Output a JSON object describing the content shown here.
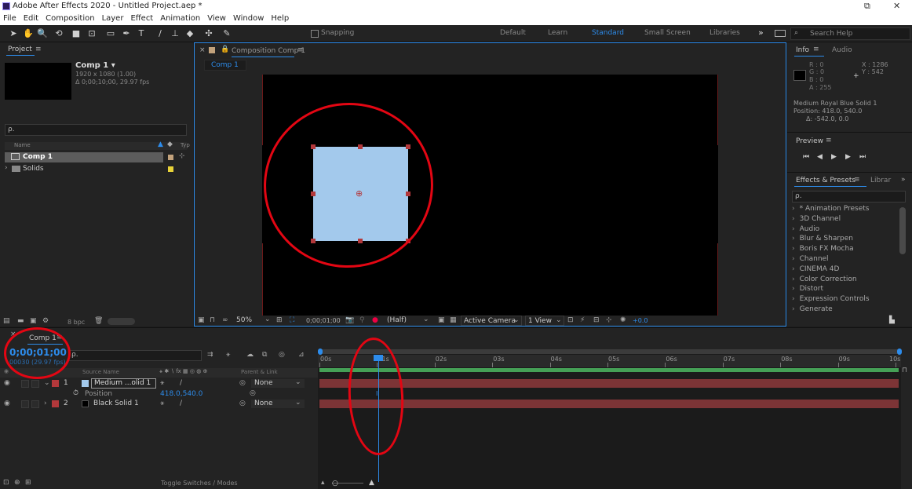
{
  "app": {
    "title": "Adobe After Effects 2020 - Untitled Project.aep *"
  },
  "menu": [
    "File",
    "Edit",
    "Composition",
    "Layer",
    "Effect",
    "Animation",
    "View",
    "Window",
    "Help"
  ],
  "window_controls": {
    "restore": "⧉",
    "close": "✕"
  },
  "workspaces": [
    "Default",
    "Learn",
    "Standard",
    "Small Screen",
    "Libraries"
  ],
  "workspace_more": "»",
  "search_help": "Search Help",
  "snapping": "Snapping",
  "project": {
    "tab": "Project",
    "comp_name": "Comp 1 ▾",
    "comp_info1": "1920 x 1080 (1.00)",
    "comp_info2": "Δ 0;00;10;00, 29.97 fps",
    "search_placeholder": "ρ.",
    "col_name": "Name",
    "col_type": "Typ",
    "items": [
      {
        "name": "Comp 1"
      },
      {
        "name": "Solids"
      }
    ],
    "bpc": "8 bpc"
  },
  "composition": {
    "tab": "Composition Comp 1",
    "flow": "Comp 1",
    "zoom": "50%",
    "timecode": "0;00;01;00",
    "resolution": "(Half)",
    "camera": "Active Camera",
    "view": "1 View",
    "exposure": "+0.0"
  },
  "info": {
    "tab": "Info",
    "tab2": "Audio",
    "r": "R : 0",
    "g": "G : 0",
    "b": "B : 0",
    "a": "A : 255",
    "x": "X : 1286",
    "y": "Y : 542",
    "layer": "Medium Royal Blue Solid 1",
    "position": "Position: 418.0, 540.0",
    "delta": "Δ: -542.0, 0.0"
  },
  "preview": {
    "tab": "Preview"
  },
  "effects": {
    "tab": "Effects & Presets",
    "tab2": "Librar",
    "search_placeholder": "ρ.",
    "items": [
      "* Animation Presets",
      "3D Channel",
      "Audio",
      "Blur & Sharpen",
      "Boris FX Mocha",
      "Channel",
      "CINEMA 4D",
      "Color Correction",
      "Distort",
      "Expression Controls",
      "Generate"
    ]
  },
  "timeline": {
    "tab": "Comp 1",
    "timecode": "0;00;01;00",
    "frame": "00030 (29.97 fps)",
    "search_placeholder": "ρ.",
    "col_source": "Source Name",
    "col_parent": "Parent & Link",
    "layers": [
      {
        "num": "1",
        "name": "Medium ...olid 1",
        "parent": "None"
      },
      {
        "num": "2",
        "name": "Black Solid 1",
        "parent": "None"
      }
    ],
    "position_label": "Position",
    "position_value": "418.0,540.0",
    "ruler": [
      "00s",
      "01s",
      "02s",
      "03s",
      "04s",
      "05s",
      "06s",
      "07s",
      "08s",
      "09s",
      "10s"
    ],
    "toggle": "Toggle Switches / Modes"
  },
  "colors": {
    "accent": "#2d8ceb",
    "annotation": "#e30613",
    "solid": "#a3c9ec",
    "label_red": "#b3383b"
  }
}
